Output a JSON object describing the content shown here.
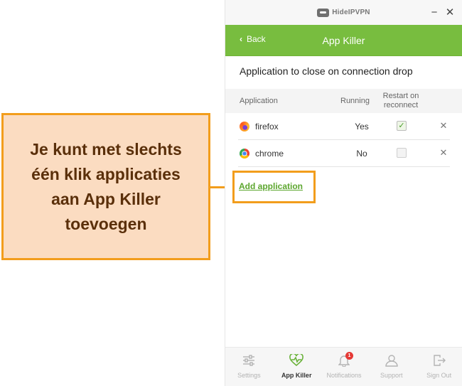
{
  "annotation": {
    "text": "Je kunt met slechts\néén klik applicaties\naan App Killer\ntoevoegen",
    "border_color": "#f29d1c",
    "background_color": "#fbdcc1"
  },
  "window": {
    "logo_text": "HideIPVPN",
    "minimize_symbol": "−",
    "close_symbol": "✕"
  },
  "header": {
    "back_label": "Back",
    "back_icon": "chevron-left-icon",
    "title": "App Killer",
    "color": "#78bd3f"
  },
  "section_title": "Application to close on connection drop",
  "table": {
    "columns": [
      "Application",
      "Running",
      "Restart on reconnect"
    ],
    "rows": [
      {
        "icon": "firefox-icon",
        "name": "firefox",
        "running": "Yes",
        "restart_on_reconnect": true
      },
      {
        "icon": "chrome-icon",
        "name": "chrome",
        "running": "No",
        "restart_on_reconnect": false
      }
    ]
  },
  "add_link": "Add application",
  "bottom_nav": {
    "items": [
      {
        "label": "Settings",
        "icon": "settings-sliders-icon",
        "active": false
      },
      {
        "label": "App Killer",
        "icon": "heart-pulse-icon",
        "active": true
      },
      {
        "label": "Notifications",
        "icon": "bell-icon",
        "active": false,
        "badge": "1"
      },
      {
        "label": "Support",
        "icon": "user-icon",
        "active": false
      },
      {
        "label": "Sign Out",
        "icon": "sign-out-icon",
        "active": false
      }
    ]
  }
}
